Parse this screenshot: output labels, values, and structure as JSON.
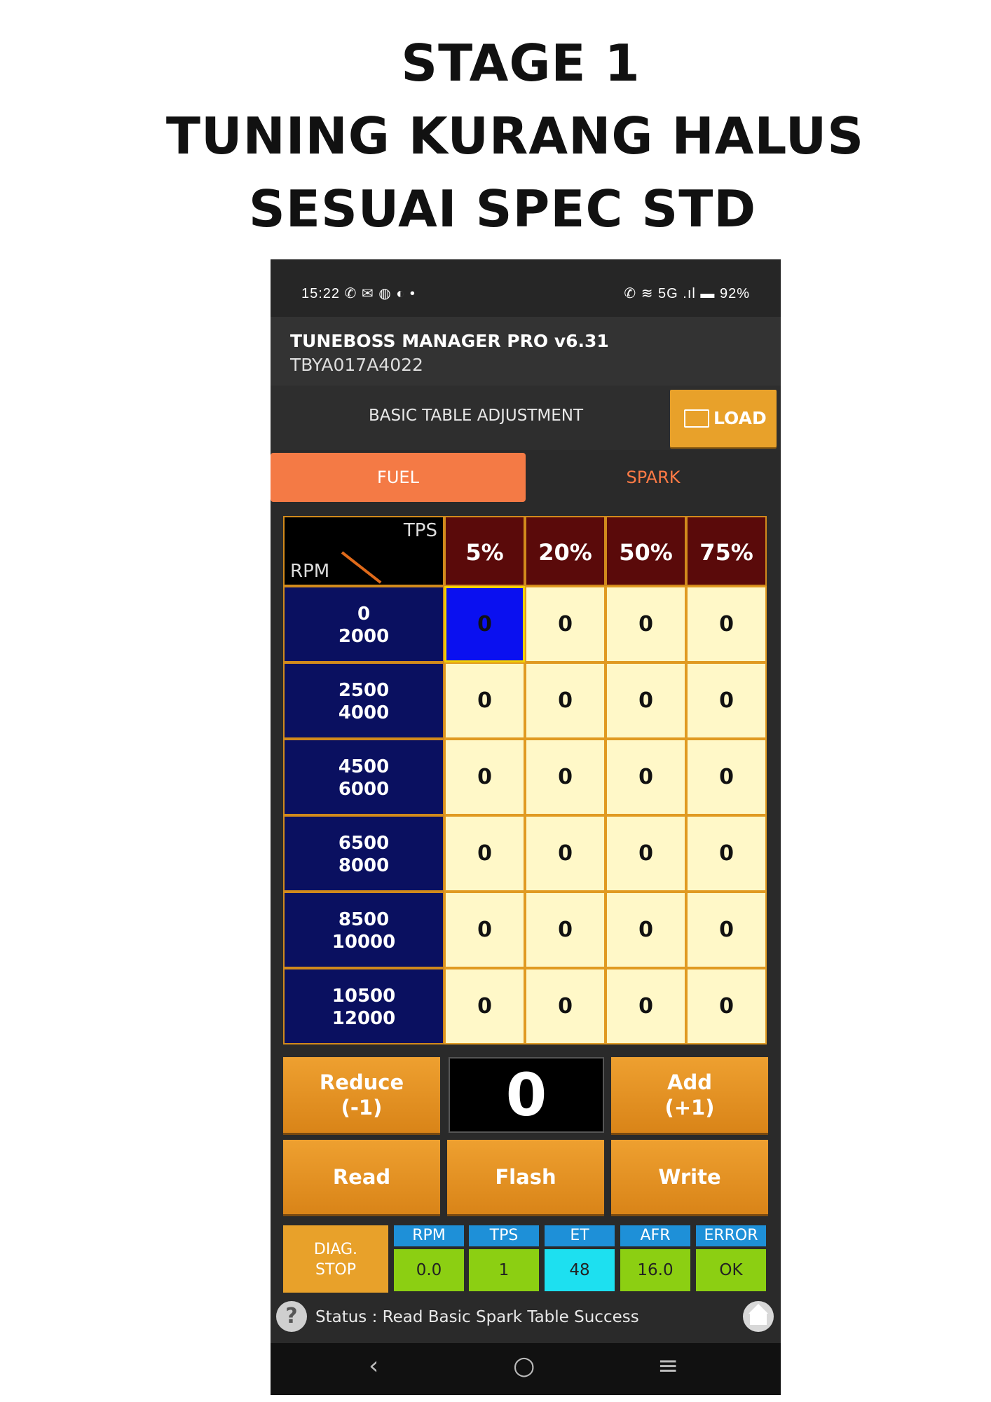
{
  "headline": [
    "STAGE 1",
    "TUNING KURANG HALUS",
    "SESUAI SPEC STD"
  ],
  "statusbar": {
    "time": "15:22",
    "left_icons": "✆ ✉ ◍ ◐ •",
    "right_icons": "✆ ≋ 5G .ıl ▬",
    "battery": "92%"
  },
  "app": {
    "title": "TUNEBOSS MANAGER PRO v6.31",
    "device_id": "TBYA017A4022"
  },
  "toolbar": {
    "title": "BASIC TABLE ADJUSTMENT",
    "load_label": "LOAD"
  },
  "tabs": {
    "fuel": "FUEL",
    "spark": "SPARK"
  },
  "table": {
    "axis_col": "TPS",
    "axis_row": "RPM",
    "columns": [
      "5%",
      "20%",
      "50%",
      "75%"
    ],
    "rows": [
      {
        "lo": "0",
        "hi": "2000",
        "values": [
          "0",
          "0",
          "0",
          "0"
        ]
      },
      {
        "lo": "2500",
        "hi": "4000",
        "values": [
          "0",
          "0",
          "0",
          "0"
        ]
      },
      {
        "lo": "4500",
        "hi": "6000",
        "values": [
          "0",
          "0",
          "0",
          "0"
        ]
      },
      {
        "lo": "6500",
        "hi": "8000",
        "values": [
          "0",
          "0",
          "0",
          "0"
        ]
      },
      {
        "lo": "8500",
        "hi": "10000",
        "values": [
          "0",
          "0",
          "0",
          "0"
        ]
      },
      {
        "lo": "10500",
        "hi": "12000",
        "values": [
          "0",
          "0",
          "0",
          "0"
        ]
      }
    ]
  },
  "controls": {
    "reduce": [
      "Reduce",
      "(-1)"
    ],
    "current_value": "0",
    "add": [
      "Add",
      "(+1)"
    ],
    "read": "Read",
    "flash": "Flash",
    "write": "Write"
  },
  "diag": {
    "button": [
      "DIAG.",
      "STOP"
    ],
    "headers": [
      "RPM",
      "TPS",
      "ET",
      "AFR",
      "ERROR"
    ],
    "values": [
      "0.0",
      "1",
      "48",
      "16.0",
      "OK"
    ]
  },
  "status": {
    "help_glyph": "?",
    "text": "Status : Read Basic Spark Table Success"
  },
  "navbar": {
    "back": "‹",
    "home": "○",
    "menu": "≡"
  }
}
